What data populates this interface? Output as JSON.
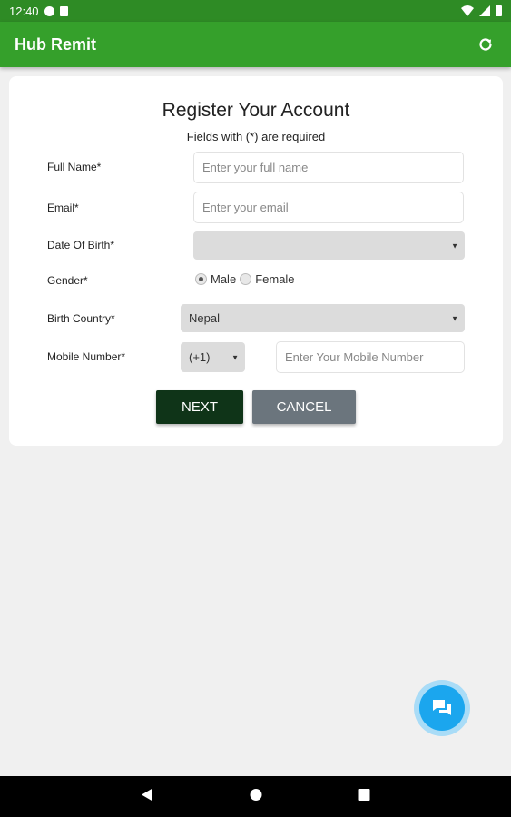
{
  "status_bar": {
    "time": "12:40"
  },
  "app_bar": {
    "title": "Hub Remit"
  },
  "form": {
    "title": "Register Your Account",
    "subtitle": "Fields with (*) are required",
    "full_name": {
      "label": "Full Name*",
      "placeholder": "Enter your full name"
    },
    "email": {
      "label": "Email*",
      "placeholder": "Enter your email"
    },
    "dob": {
      "label": "Date Of Birth*",
      "value": ""
    },
    "gender": {
      "label": "Gender*",
      "options": [
        "Male",
        "Female"
      ],
      "selected": "Male"
    },
    "birth_country": {
      "label": "Birth Country*",
      "value": "Nepal"
    },
    "mobile": {
      "label": "Mobile Number*",
      "code": "(+1)",
      "placeholder": "Enter Your Mobile Number"
    },
    "next_label": "NEXT",
    "cancel_label": "CANCEL"
  },
  "colors": {
    "status_bar": "#2e8b25",
    "app_bar": "#35a02b",
    "next_button": "#0f3418",
    "cancel_button": "#6b757d",
    "fab": "#1ba6ee"
  },
  "icons": [
    "refresh-icon",
    "chat-icon",
    "back-icon",
    "home-icon",
    "recents-icon",
    "wifi-icon",
    "signal-icon",
    "battery-icon"
  ]
}
